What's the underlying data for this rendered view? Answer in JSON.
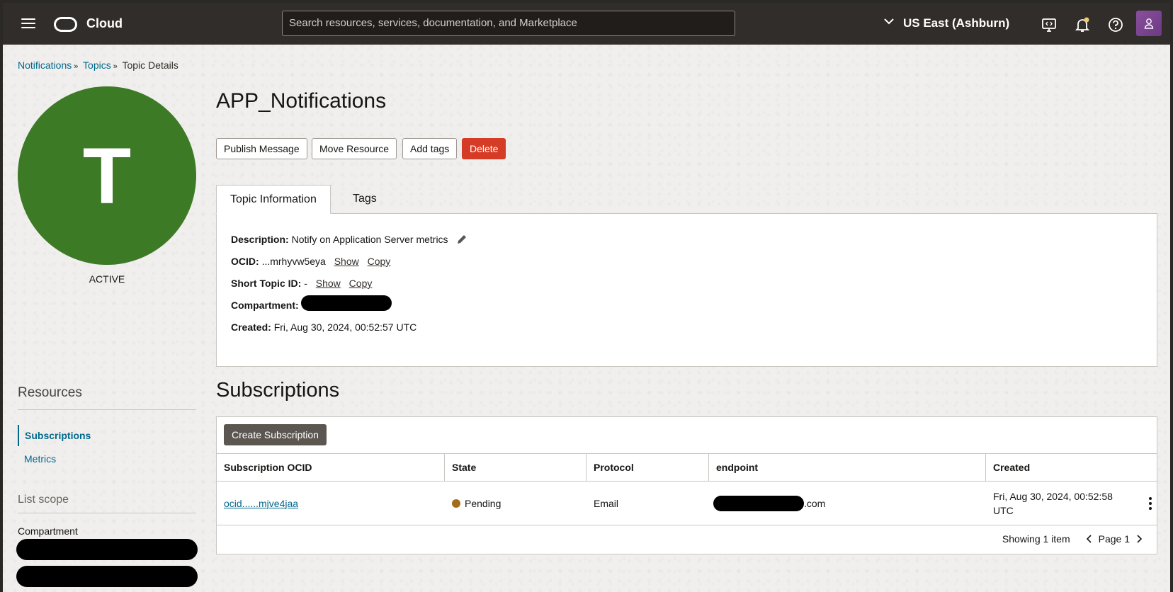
{
  "header": {
    "brand": "Cloud",
    "search_placeholder": "Search resources, services, documentation, and Marketplace",
    "region": "US East (Ashburn)",
    "icons": [
      "menu-icon",
      "oracle-logo",
      "chevron-down-icon",
      "developer-tools-icon",
      "bell-icon",
      "help-icon",
      "user-icon"
    ]
  },
  "breadcrumb": {
    "items": [
      "Notifications",
      "Topics"
    ],
    "current": "Topic Details"
  },
  "topic": {
    "avatar_letter": "T",
    "state": "ACTIVE",
    "name": "APP_Notifications",
    "avatar_color": "#3c7a26"
  },
  "actions": {
    "publish": "Publish Message",
    "move": "Move Resource",
    "add_tags": "Add tags",
    "delete": "Delete"
  },
  "tabs": [
    "Topic Information",
    "Tags"
  ],
  "info": {
    "description_label": "Description:",
    "description_value": "Notify on Application Server metrics",
    "ocid_label": "OCID:",
    "ocid_value": "...mrhyvw5eya",
    "show": "Show",
    "copy": "Copy",
    "short_id_label": "Short Topic ID:",
    "short_id_value": "-",
    "compartment_label": "Compartment:",
    "created_label": "Created:",
    "created_value": "Fri, Aug 30, 2024, 00:52:57 UTC"
  },
  "resources": {
    "title": "Resources",
    "items": [
      "Subscriptions",
      "Metrics"
    ],
    "scope_title": "List scope",
    "compartment_label": "Compartment"
  },
  "subscriptions": {
    "title": "Subscriptions",
    "create_button": "Create Subscription",
    "columns": [
      "Subscription OCID",
      "State",
      "Protocol",
      "endpoint",
      "Created"
    ],
    "rows": [
      {
        "ocid": "ocid......mjve4jaa",
        "state": "Pending",
        "protocol": "Email",
        "endpoint_suffix": ".com",
        "created_line1": "Fri, Aug 30, 2024, 00:52:58",
        "created_line2": "UTC"
      }
    ],
    "showing": "Showing 1 item",
    "page": "Page 1",
    "state_color": "#a36c1b"
  }
}
